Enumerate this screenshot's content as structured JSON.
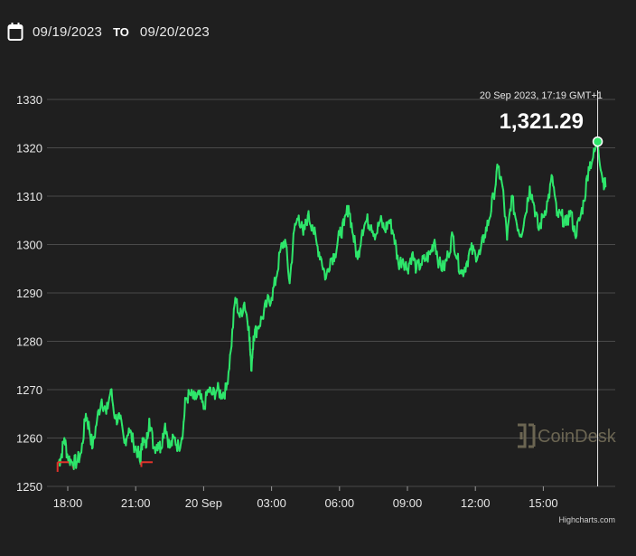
{
  "header": {
    "start_date": "09/19/2023",
    "to_label": "TO",
    "end_date": "09/20/2023",
    "icon": "calendar-icon"
  },
  "tooltip": {
    "date": "20 Sep 2023, 17:19 GMT+1",
    "value": "1,321.29"
  },
  "watermark": {
    "text": "CoinDesk",
    "icon": "coindesk-logo-icon"
  },
  "credit": "Highcharts.com",
  "colors": {
    "background": "#1f1f1f",
    "up": "#2ee66b",
    "down": "#e0322a",
    "grid": "#4a4a4a"
  },
  "chart_data": {
    "type": "line",
    "xlabel": "",
    "ylabel": "",
    "ylim": [
      1250,
      1330
    ],
    "yticks": [
      "1250",
      "1260",
      "1270",
      "1280",
      "1290",
      "1300",
      "1310",
      "1320",
      "1330"
    ],
    "xlim_hours": [
      17.5,
      17.9
    ],
    "xtick_labels": [
      "18:00",
      "21:00",
      "20 Sep",
      "03:00",
      "06:00",
      "09:00",
      "12:00",
      "15:00"
    ],
    "xtick_hours": [
      18,
      21,
      24,
      27,
      30,
      33,
      36,
      39
    ],
    "grid": true,
    "legend": "none",
    "series": [
      {
        "points": [
          [
            17.6,
            1255
          ],
          [
            17.7,
            1256
          ],
          [
            17.85,
            1260
          ],
          [
            18.0,
            1256
          ],
          [
            18.2,
            1255
          ],
          [
            18.4,
            1255
          ],
          [
            18.6,
            1257
          ],
          [
            18.8,
            1265
          ],
          [
            18.95,
            1262
          ],
          [
            19.1,
            1258
          ],
          [
            19.3,
            1264
          ],
          [
            19.5,
            1268
          ],
          [
            19.7,
            1265
          ],
          [
            19.9,
            1270
          ],
          [
            20.1,
            1264
          ],
          [
            20.3,
            1264
          ],
          [
            20.5,
            1259
          ],
          [
            20.7,
            1262
          ],
          [
            20.9,
            1259
          ],
          [
            21.1,
            1257
          ],
          [
            21.2,
            1255
          ],
          [
            21.3,
            1260
          ],
          [
            21.45,
            1258
          ],
          [
            21.6,
            1264
          ],
          [
            21.8,
            1258
          ],
          [
            22.0,
            1259
          ],
          [
            22.1,
            1258
          ],
          [
            22.3,
            1263
          ],
          [
            22.5,
            1258
          ],
          [
            22.7,
            1260
          ],
          [
            22.9,
            1258
          ],
          [
            23.1,
            1262
          ],
          [
            23.2,
            1268
          ],
          [
            23.4,
            1269
          ],
          [
            23.6,
            1268
          ],
          [
            23.8,
            1269
          ],
          [
            24.0,
            1266
          ],
          [
            24.2,
            1270
          ],
          [
            24.4,
            1269
          ],
          [
            24.6,
            1270
          ],
          [
            24.8,
            1269
          ],
          [
            25.0,
            1270
          ],
          [
            25.2,
            1278
          ],
          [
            25.4,
            1289
          ],
          [
            25.6,
            1285
          ],
          [
            25.8,
            1288
          ],
          [
            26.0,
            1283
          ],
          [
            26.1,
            1274
          ],
          [
            26.2,
            1281
          ],
          [
            26.4,
            1283
          ],
          [
            26.6,
            1285
          ],
          [
            26.8,
            1288
          ],
          [
            27.0,
            1289
          ],
          [
            27.2,
            1293
          ],
          [
            27.4,
            1299
          ],
          [
            27.6,
            1301
          ],
          [
            27.8,
            1292
          ],
          [
            28.0,
            1303
          ],
          [
            28.2,
            1306
          ],
          [
            28.4,
            1302
          ],
          [
            28.6,
            1306
          ],
          [
            28.8,
            1304
          ],
          [
            29.0,
            1300
          ],
          [
            29.2,
            1297
          ],
          [
            29.4,
            1293
          ],
          [
            29.6,
            1297
          ],
          [
            29.8,
            1298
          ],
          [
            30.0,
            1302
          ],
          [
            30.2,
            1304
          ],
          [
            30.4,
            1308
          ],
          [
            30.6,
            1302
          ],
          [
            30.8,
            1297
          ],
          [
            31.0,
            1303
          ],
          [
            31.2,
            1305
          ],
          [
            31.4,
            1304
          ],
          [
            31.6,
            1302
          ],
          [
            31.8,
            1305
          ],
          [
            32.0,
            1303
          ],
          [
            32.2,
            1305
          ],
          [
            32.4,
            1302
          ],
          [
            32.6,
            1296
          ],
          [
            32.8,
            1297
          ],
          [
            33.0,
            1295
          ],
          [
            33.2,
            1298
          ],
          [
            33.4,
            1295
          ],
          [
            33.6,
            1296
          ],
          [
            33.8,
            1297
          ],
          [
            34.0,
            1298
          ],
          [
            34.2,
            1301
          ],
          [
            34.4,
            1296
          ],
          [
            34.6,
            1295
          ],
          [
            34.8,
            1298
          ],
          [
            35.0,
            1302
          ],
          [
            35.2,
            1297
          ],
          [
            35.4,
            1294
          ],
          [
            35.6,
            1296
          ],
          [
            35.8,
            1299
          ],
          [
            36.0,
            1298
          ],
          [
            36.2,
            1298
          ],
          [
            36.4,
            1302
          ],
          [
            36.6,
            1305
          ],
          [
            36.8,
            1310
          ],
          [
            37.0,
            1316
          ],
          [
            37.2,
            1312
          ],
          [
            37.4,
            1301
          ],
          [
            37.6,
            1310
          ],
          [
            37.8,
            1305
          ],
          [
            38.0,
            1302
          ],
          [
            38.2,
            1306
          ],
          [
            38.4,
            1312
          ],
          [
            38.6,
            1308
          ],
          [
            38.8,
            1303
          ],
          [
            39.0,
            1306
          ],
          [
            39.2,
            1309
          ],
          [
            39.4,
            1314
          ],
          [
            39.6,
            1306
          ],
          [
            39.8,
            1306
          ],
          [
            40.0,
            1304
          ],
          [
            40.2,
            1307
          ],
          [
            40.4,
            1302
          ],
          [
            40.6,
            1305
          ],
          [
            40.8,
            1309
          ],
          [
            41.0,
            1316
          ],
          [
            41.2,
            1318
          ],
          [
            41.4,
            1321.3
          ],
          [
            41.6,
            1314
          ],
          [
            41.75,
            1312
          ]
        ]
      }
    ],
    "highlight": {
      "x": 41.4,
      "y": 1321.29
    }
  }
}
